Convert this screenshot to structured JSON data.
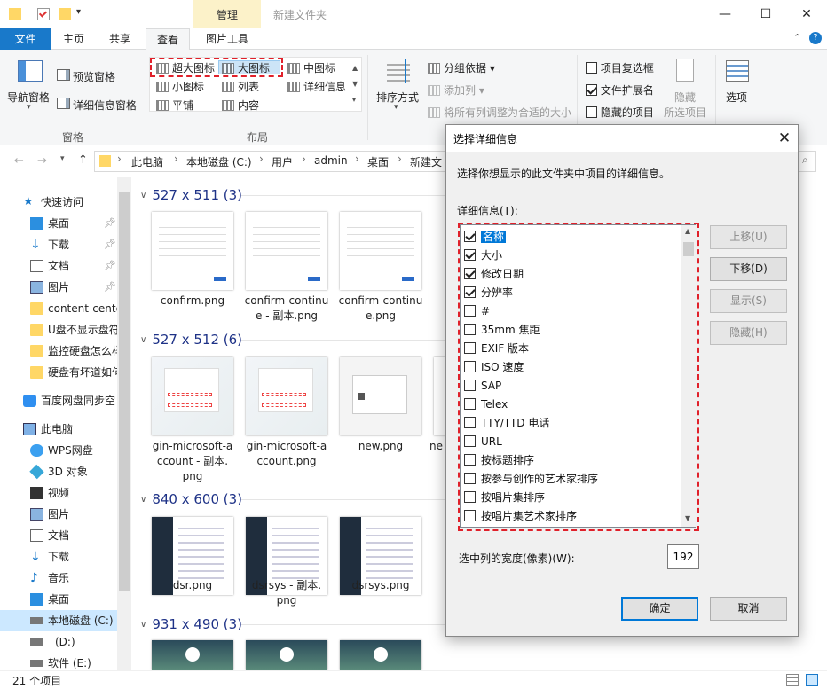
{
  "window": {
    "title": "新建文件夹",
    "context_tab": "管理",
    "minimize": "—",
    "maximize": "☐",
    "close": "✕"
  },
  "ribbon_tabs": {
    "file": "文件",
    "home": "主页",
    "share": "共享",
    "view": "查看",
    "picture_tools": "图片工具"
  },
  "ribbon": {
    "nav_pane": "导航窗格",
    "preview_pane": "预览窗格",
    "details_pane": "详细信息窗格",
    "panes_group": "窗格",
    "layout": {
      "extra_large": "超大图标",
      "large": "大图标",
      "medium": "中图标",
      "small": "小图标",
      "list": "列表",
      "details": "详细信息",
      "tiles": "平铺",
      "content": "内容"
    },
    "layout_group": "布局",
    "sort_by": "排序方式",
    "group_by": "分组依据",
    "add_columns": "添加列",
    "size_all_columns": "将所有列调整为合适的大小",
    "item_checkboxes": "项目复选框",
    "file_extensions": "文件扩展名",
    "hidden_items": "隐藏的项目",
    "hide_selected": "隐藏",
    "hide_selected_2": "所选项目",
    "options": "选项"
  },
  "address": {
    "crumbs": [
      "此电脑",
      "本地磁盘 (C:)",
      "用户",
      "admin",
      "桌面",
      "新建文"
    ]
  },
  "nav": {
    "quick_access": "快速访问",
    "items": [
      "桌面",
      "下载",
      "文档",
      "图片",
      "content-cente",
      "U盘不显示盘符",
      "监控硬盘怎么样",
      "硬盘有坏道如何"
    ],
    "baidu": "百度网盘同步空",
    "this_pc": "此电脑",
    "pc_items": [
      "WPS网盘",
      "3D 对象",
      "视频",
      "图片",
      "文档",
      "下载",
      "音乐",
      "桌面",
      "本地磁盘 (C:)",
      "(D:)",
      "软件 (E:)"
    ]
  },
  "groups": [
    {
      "header": "527 x 511 (3)",
      "files": [
        "confirm.png",
        "confirm-continue - 副本.png",
        "confirm-continue.png"
      ]
    },
    {
      "header": "527 x 512 (6)",
      "files": [
        "gin-microsoft-account - 副本.png",
        "gin-microsoft-account.png",
        "new.png",
        "ne"
      ]
    },
    {
      "header": "840 x 600 (3)",
      "files": [
        "dsr.png",
        "dsrsys - 副本.png",
        "dsrsys.png"
      ]
    },
    {
      "header": "931 x 490 (3)",
      "files": []
    }
  ],
  "captions": {
    "c1": [
      "confirm.png"
    ],
    "c2": [
      "confirm-continu",
      "e - 副本.png"
    ],
    "c3": [
      "confirm-continu",
      "e.png"
    ],
    "c4": [
      "gin-microsoft-a",
      "ccount - 副本.",
      "png"
    ],
    "c5": [
      "gin-microsoft-a",
      "ccount.png"
    ],
    "c6": [
      "new.png"
    ],
    "c7": [
      "ne"
    ],
    "c8": [
      "dsr.png"
    ],
    "c9": [
      "dsrsys - 副本.",
      "png"
    ],
    "c10": [
      "dsrsys.png"
    ]
  },
  "status": {
    "count": "21 个项目"
  },
  "dialog": {
    "title": "选择详细信息",
    "description": "选择你想显示的此文件夹中项目的详细信息。",
    "list_label": "详细信息(T):",
    "items": [
      {
        "label": "名称",
        "checked": true
      },
      {
        "label": "大小",
        "checked": true
      },
      {
        "label": "修改日期",
        "checked": true
      },
      {
        "label": "分辨率",
        "checked": true
      },
      {
        "label": "#",
        "checked": false
      },
      {
        "label": "35mm 焦距",
        "checked": false
      },
      {
        "label": "EXIF 版本",
        "checked": false
      },
      {
        "label": "ISO 速度",
        "checked": false
      },
      {
        "label": "SAP",
        "checked": false
      },
      {
        "label": "Telex",
        "checked": false
      },
      {
        "label": "TTY/TTD 电话",
        "checked": false
      },
      {
        "label": "URL",
        "checked": false
      },
      {
        "label": "按标题排序",
        "checked": false
      },
      {
        "label": "按参与创作的艺术家排序",
        "checked": false
      },
      {
        "label": "按唱片集排序",
        "checked": false
      },
      {
        "label": "按唱片集艺术家排序",
        "checked": false
      }
    ],
    "move_up": "上移(U)",
    "move_down": "下移(D)",
    "show": "显示(S)",
    "hide": "隐藏(H)",
    "width_label": "选中列的宽度(像素)(W):",
    "width_value": "192",
    "ok": "确定",
    "cancel": "取消"
  },
  "colors": {
    "accent": "#1979ca",
    "highlight": "#e0202a",
    "group_header": "#1e3287"
  }
}
